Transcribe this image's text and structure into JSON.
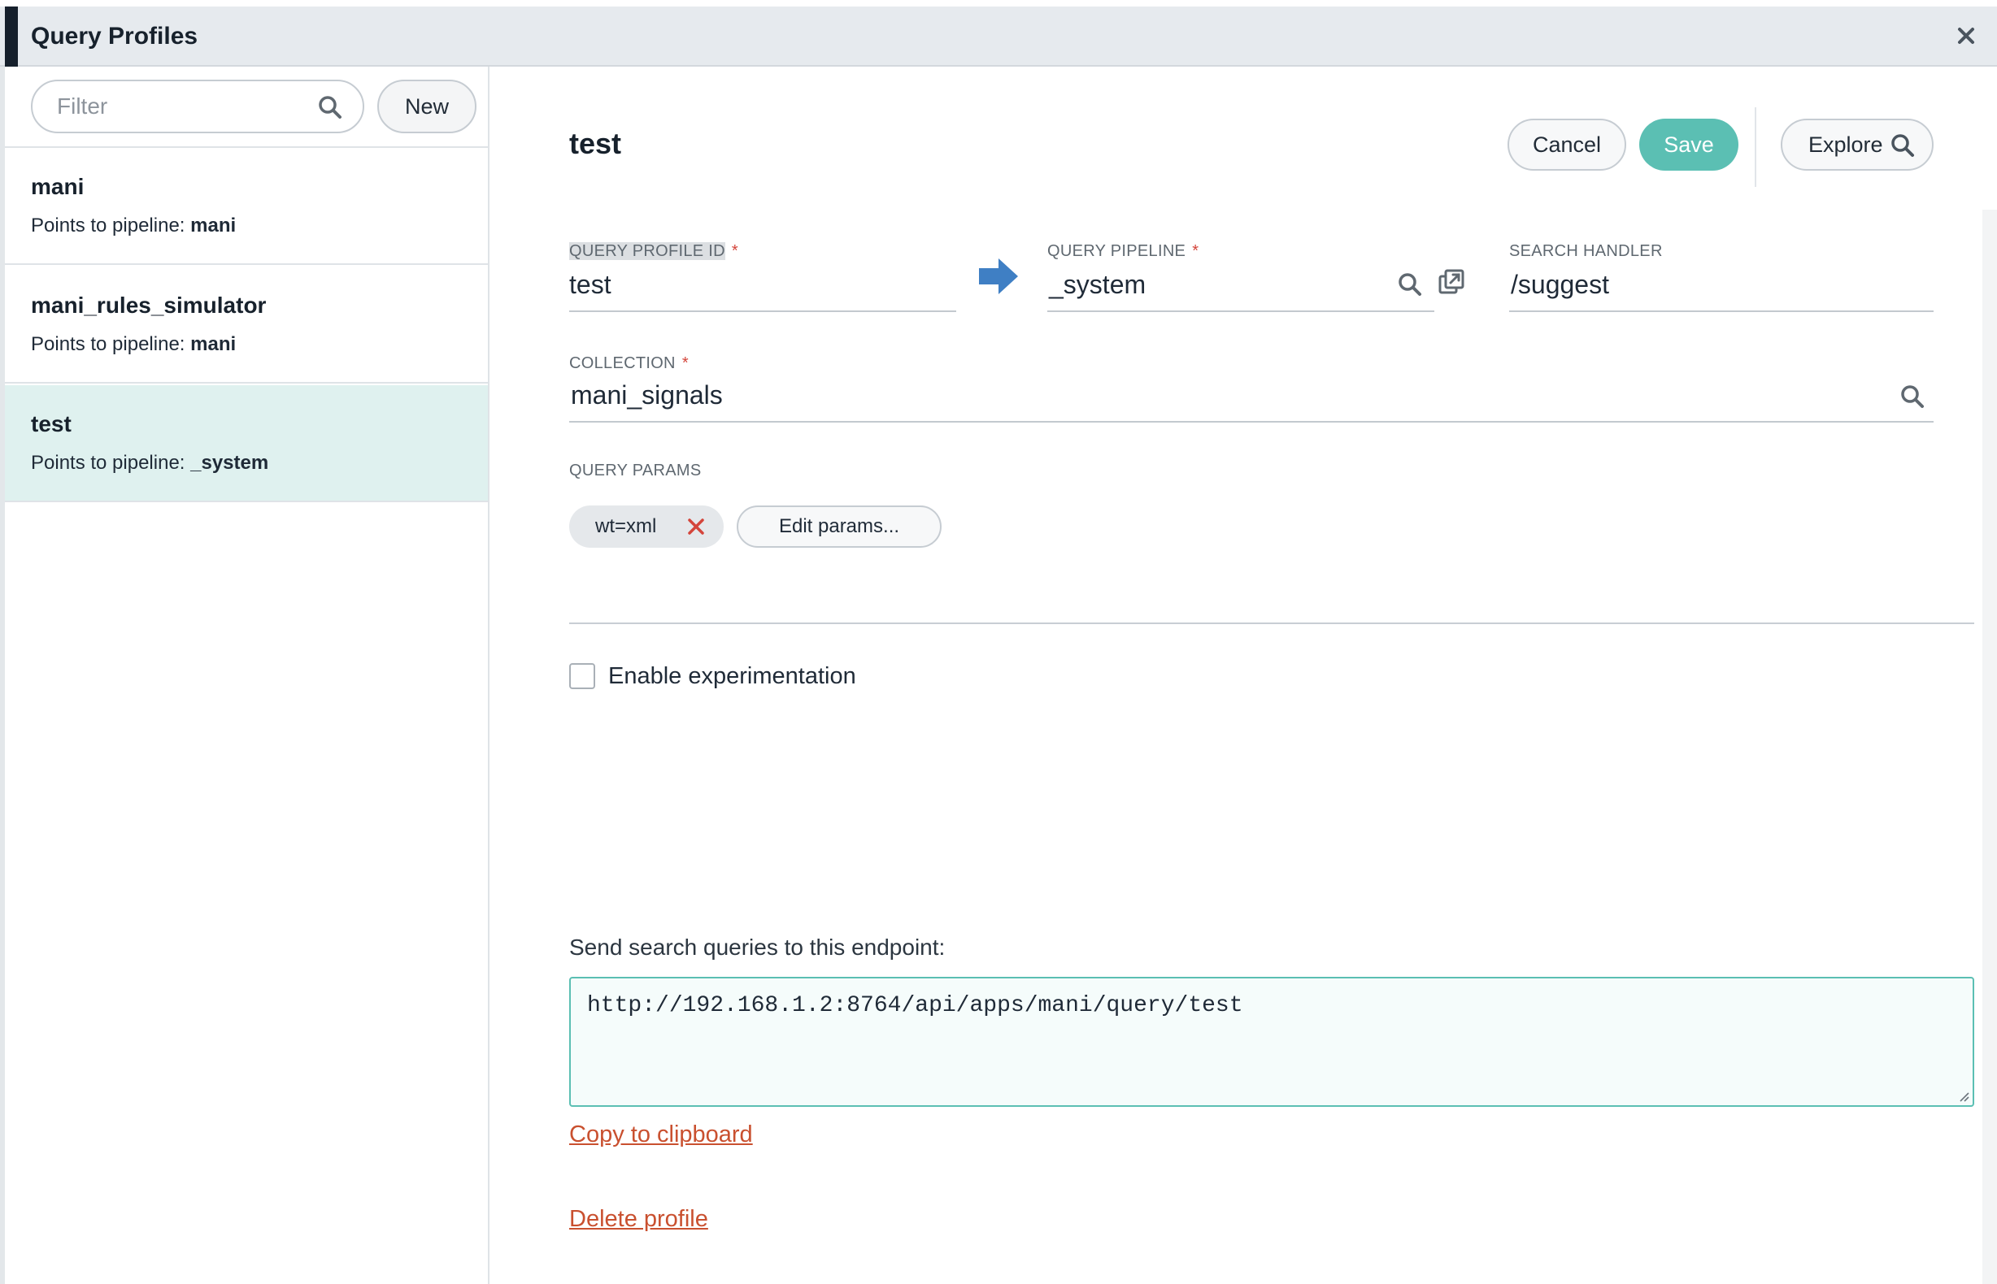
{
  "window": {
    "title": "Query Profiles",
    "close_icon": "close-icon"
  },
  "sidebar": {
    "filter_placeholder": "Filter",
    "filter_value": "",
    "new_label": "New",
    "items": [
      {
        "name": "mani",
        "prefix": "Points to pipeline: ",
        "pipeline": "mani",
        "selected": false
      },
      {
        "name": "mani_rules_simulator",
        "prefix": "Points to pipeline: ",
        "pipeline": "mani",
        "selected": false
      },
      {
        "name": "test",
        "prefix": "Points to pipeline: ",
        "pipeline": "_system",
        "selected": true
      }
    ]
  },
  "main": {
    "title": "test",
    "cancel_label": "Cancel",
    "save_label": "Save",
    "explore_label": "Explore",
    "profile_id": {
      "label": "QUERY PROFILE ID",
      "required": "*",
      "value": "test"
    },
    "pipeline": {
      "label": "QUERY PIPELINE",
      "required": "*",
      "value": "_system"
    },
    "handler": {
      "label": "SEARCH HANDLER",
      "value": "/suggest"
    },
    "collection": {
      "label": "COLLECTION",
      "required": "*",
      "value": "mani_signals"
    },
    "params": {
      "label": "QUERY PARAMS",
      "chip": "wt=xml",
      "edit_label": "Edit params..."
    },
    "experimentation": {
      "label": "Enable experimentation",
      "checked": false
    },
    "endpoint": {
      "label": "Send search queries to this endpoint:",
      "url": "http://192.168.1.2:8764/api/apps/mani/query/test"
    },
    "copy_label": "Copy to clipboard",
    "delete_label": "Delete profile"
  },
  "colors": {
    "accent": "#5bbfb3",
    "selected_bg": "#dff1ef",
    "arrow": "#3f7fc4",
    "link": "#c9502f",
    "required": "#d4453b"
  }
}
